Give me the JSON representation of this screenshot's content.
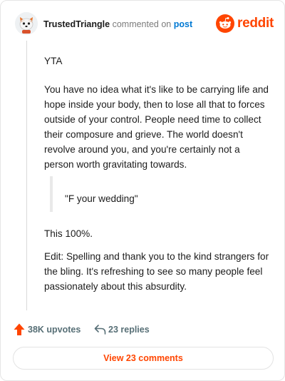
{
  "header": {
    "author": "TrustedTriangle",
    "action_text": "commented on",
    "post_link": "post",
    "brand": "reddit"
  },
  "icons": {
    "avatar": "avatar-fox-icon",
    "brand": "reddit-logo-icon",
    "upvote": "upvote-arrow-icon",
    "reply": "reply-arrow-icon"
  },
  "colors": {
    "brand_orange": "#ff4500",
    "link_blue": "#0079d3",
    "meta_gray": "#576f76",
    "upvote_orange": "#ff4500"
  },
  "comment": {
    "p1": "YTA",
    "p2": "You have no idea what it's like to be carrying life and hope inside your body, then to lose all that to forces outside of your control. People need time to collect their composure and grieve. The world doesn't revolve around you, and you're certainly not a person worth gravitating towards.",
    "quote": "\"F your wedding\"",
    "p3": "This 100%.",
    "p4": "Edit: Spelling and thank you to the kind strangers for the bling. It's refreshing to see so many people feel passionately about this absurdity."
  },
  "actions": {
    "upvotes": "38K upvotes",
    "replies": "23 replies"
  },
  "view_button": "View 23 comments"
}
